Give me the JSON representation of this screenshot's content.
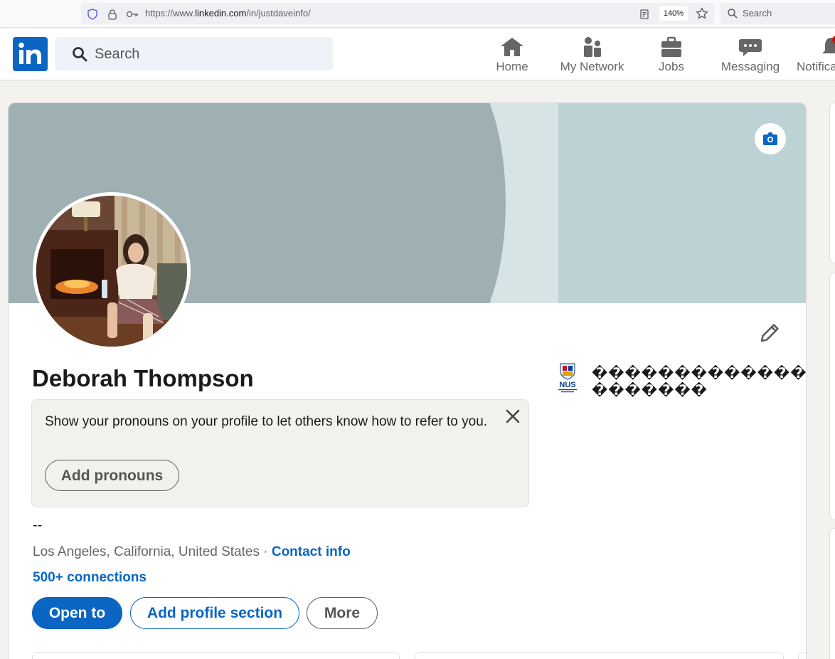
{
  "browser": {
    "url_prefix": "https://www.",
    "url_domain": "linkedin.com",
    "url_path": "/in/justdaveinfo/",
    "zoom": "140%",
    "search_placeholder": "Search"
  },
  "header": {
    "logo_text": "in",
    "search_placeholder": "Search",
    "nav": [
      {
        "label": "Home",
        "icon": "home-icon"
      },
      {
        "label": "My Network",
        "icon": "network-icon"
      },
      {
        "label": "Jobs",
        "icon": "briefcase-icon"
      },
      {
        "label": "Messaging",
        "icon": "chat-icon"
      },
      {
        "label": "Notifica",
        "icon": "bell-icon"
      }
    ]
  },
  "profile": {
    "name": "Deborah Thompson",
    "pronoun_prompt": "Show your pronouns on your profile to let others know how to refer to you.",
    "add_pronouns_label": "Add pronouns",
    "headline": "--",
    "location": "Los Angeles, California, United States",
    "separator": " · ",
    "contact_info_label": "Contact info",
    "connections_label": "500+ connections",
    "open_to_label": "Open to",
    "add_section_label": "Add profile section",
    "more_label": "More",
    "education": {
      "logo_text": "NUS",
      "name_line1": "��������������",
      "name_line2": "�������"
    }
  },
  "colors": {
    "brand_blue": "#0a66c2",
    "cover_left": "#9eb0b1",
    "cover_right": "#bcd2d5",
    "page_bg": "#f3f2ef"
  }
}
